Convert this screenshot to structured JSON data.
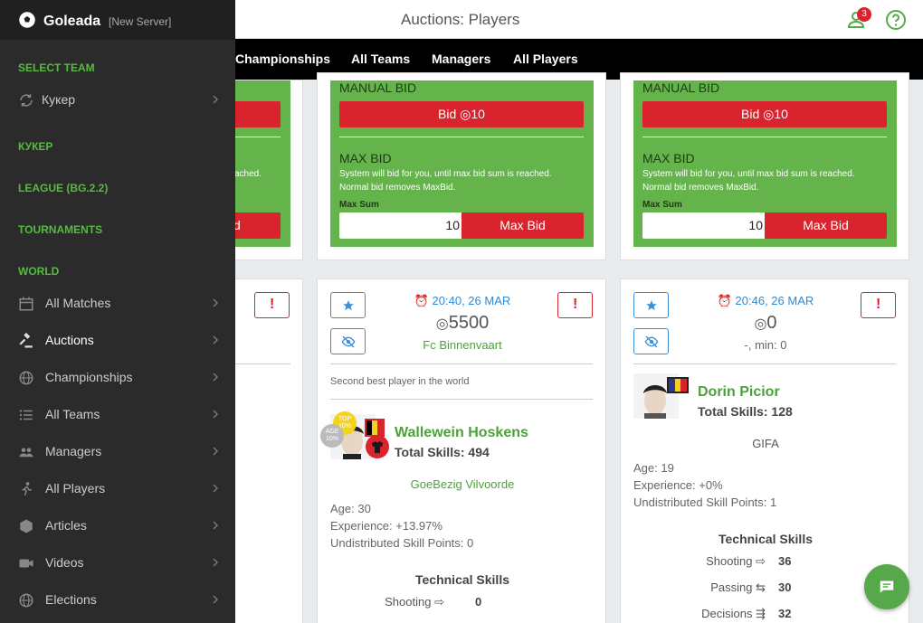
{
  "app": {
    "brand": "Goleada",
    "server": "[New Server]"
  },
  "header": {
    "title": "Auctions: Players",
    "notifications": "3"
  },
  "nav": [
    "Championships",
    "All Teams",
    "Managers",
    "All Players"
  ],
  "sidebar": {
    "select_team_label": "SELECT TEAM",
    "team_switch": "Кукер",
    "team_section": "КУКЕР",
    "league_section": "LEAGUE (BG.2.2)",
    "tournaments_section": "TOURNAMENTS",
    "world_section": "WORLD",
    "items": [
      "All Matches",
      "Auctions",
      "Championships",
      "All Teams",
      "Managers",
      "All Players",
      "Articles",
      "Videos",
      "Elections"
    ]
  },
  "bid_panel": {
    "manual_bid": "MANUAL BID",
    "bid_button": "Bid ◎10",
    "max_bid": "MAX BID",
    "desc_line1": "System will bid for you, until max bid sum is reached.",
    "desc_line2": "Normal bid removes MaxBid.",
    "partial_desc": "ached.",
    "max_sum_label": "Max Sum",
    "max_sum_value": "10",
    "max_bid_button": "Max Bid",
    "partial_button": "d"
  },
  "auctions": [
    {
      "time": "20:40, 26 MAR",
      "price": "5500",
      "seller": "Fc Binnenvaart",
      "note": "Second best player in the world",
      "badge_top": "TOP 10%",
      "badge_age": "AGE 10%",
      "name": "Wallewein Hoskens",
      "total_skills": "Total Skills: 494",
      "team": "GoeBezig Vilvoorde",
      "age": "Age: 30",
      "experience": "Experience: +13.97%",
      "usp": "Undistributed Skill Points: 0",
      "tech_title": "Technical Skills",
      "skills": [
        {
          "name": "Shooting",
          "value": "0"
        }
      ]
    },
    {
      "time": "20:46, 26 MAR",
      "price": "0",
      "seller": "-, min: 0",
      "name": "Dorin Picior",
      "total_skills": "Total Skills: 128",
      "team": "GIFA",
      "age": "Age: 19",
      "experience": "Experience: +0%",
      "usp": "Undistributed Skill Points: 1",
      "tech_title": "Technical Skills",
      "skills": [
        {
          "name": "Shooting",
          "value": "36"
        },
        {
          "name": "Passing",
          "value": "30"
        },
        {
          "name": "Decisions",
          "value": "32"
        }
      ]
    }
  ],
  "colors": {
    "accent": "#57bb3f",
    "panel": "#64b44b",
    "danger": "#d9232d",
    "link": "#2f8ad0"
  }
}
